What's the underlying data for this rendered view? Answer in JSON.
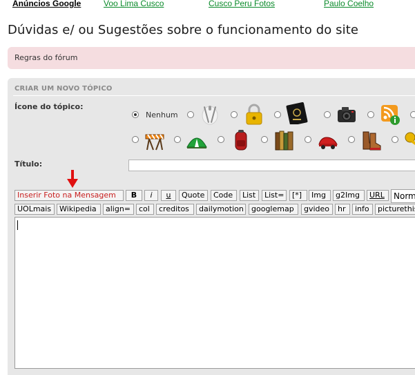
{
  "ads": {
    "label": "Anúncios Google",
    "links": [
      "Voo Lima Cusco",
      "Cusco Peru Fotos",
      "Paulo Coelho"
    ]
  },
  "page_title": "Dúvidas e/ ou Sugestões sobre o funcionamento do site",
  "rules_label": "Regras do fórum",
  "form": {
    "heading": "CRIAR UM NOVO TÓPICO",
    "icon_label": "Ícone do tópico:",
    "icon_none": "Nenhum",
    "title_label": "Título:",
    "title_value": "",
    "icons": [
      "silverware-icon",
      "padlock-icon",
      "passport-icon",
      "camera-icon",
      "rss-info-icon",
      "roadblock-icon",
      "tent-icon",
      "backpack-icon",
      "books-icon",
      "car-icon",
      "hiking-boots-icon",
      "key-icon"
    ],
    "selected_icon": "Nenhum"
  },
  "toolbar_row1": [
    "Inserir Foto na Mensagem",
    "B",
    "i",
    "u",
    "Quote",
    "Code",
    "List",
    "List=",
    "[*]",
    "Img",
    "g2Img",
    "URL"
  ],
  "font_size_select": "Normal",
  "toolbar_row2": [
    "UOLmais",
    "Wikipedia",
    "align=",
    "col",
    "creditos",
    "dailymotion",
    "googlemap",
    "gvideo",
    "hr",
    "info",
    "picturethis"
  ],
  "message_value": "",
  "colors": {
    "link_green": "#0a8a2a",
    "rules_bg": "#f5dde0",
    "panel_bg": "#e7e7e7",
    "arrow_red": "#e01010",
    "red_button": "#c81e1e"
  }
}
